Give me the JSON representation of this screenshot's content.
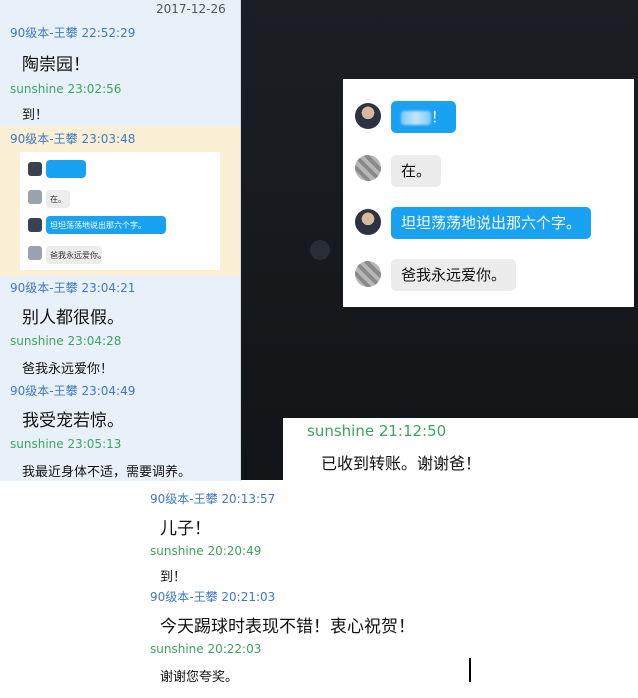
{
  "left_chat": {
    "date": "2017-12-26",
    "messages": [
      {
        "sender": "90级本-王攀",
        "time": "22:52:29",
        "text": "陶崇园！"
      },
      {
        "sender": "sunshine",
        "time": "23:02:56",
        "text": "到！"
      },
      {
        "sender": "90级本-王攀",
        "time": "23:03:48",
        "text": ""
      },
      {
        "sender": "90级本-王攀",
        "time": "23:04:21",
        "text": "别人都很假。"
      },
      {
        "sender": "sunshine",
        "time": "23:04:28",
        "text": "爸我永远爱你！"
      },
      {
        "sender": "90级本-王攀",
        "time": "23:04:49",
        "text": "我受宠若惊。"
      },
      {
        "sender": "sunshine",
        "time": "23:05:13",
        "text": "我最近身体不适，需要调养。"
      }
    ],
    "embedded": {
      "m1": "在。",
      "m2": "坦坦荡荡地说出那六个字。",
      "m3": "爸我永远爱你。"
    }
  },
  "chat_card": {
    "bubbles": [
      {
        "side": "blue",
        "text": "！"
      },
      {
        "side": "gray",
        "text": "在。"
      },
      {
        "side": "blue",
        "text": "坦坦荡荡地说出那六个字。"
      },
      {
        "side": "gray",
        "text": "爸我永远爱你。"
      }
    ]
  },
  "sun_chat": {
    "header": "sunshine 21:12:50",
    "text": "已收到转账。谢谢爸！"
  },
  "bottom_chat": {
    "messages": [
      {
        "header": "90级本-王攀 20:13:57",
        "text": "儿子！"
      },
      {
        "header": "sunshine 20:20:49",
        "text": "到！"
      },
      {
        "header": "90级本-王攀 20:21:03",
        "text": "今天踢球时表现不错！衷心祝贺！"
      },
      {
        "header": "sunshine 20:22:03",
        "text": "谢谢您夸奖。"
      }
    ]
  },
  "colors": {
    "blue_name": "#3d79c8",
    "green_name": "#3fa45b",
    "bubble_blue": "#1aa2f2",
    "bubble_gray": "#ececec",
    "highlight": "#fbefd5"
  }
}
